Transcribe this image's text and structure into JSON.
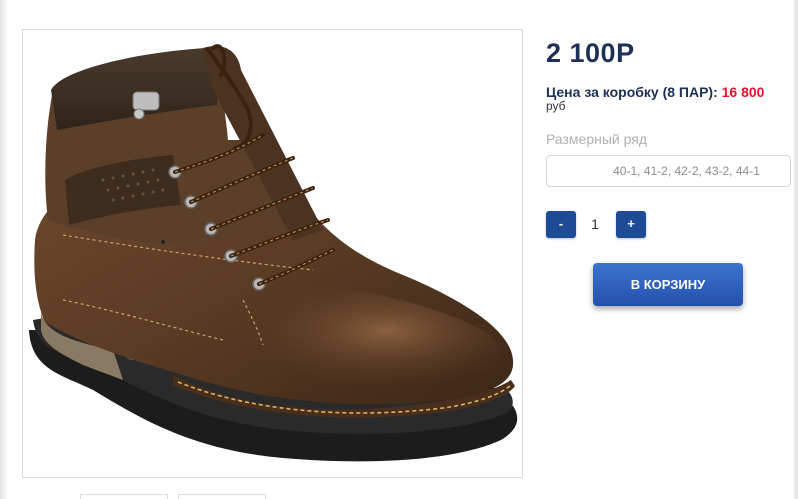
{
  "product": {
    "price": "2 100Р",
    "box_price_label": "Цена за коробку (8 ПАР):",
    "box_price_value": "16 800",
    "box_price_currency": "руб",
    "size_label": "Размерный ряд",
    "size_value": "40-1, 41-2, 42-2, 43-2, 44-1",
    "quantity": "1",
    "minus_label": "-",
    "plus_label": "+",
    "cart_button_label": "В КОРЗИНУ"
  },
  "image": {
    "subject": "brown-leather-lace-up-boot"
  },
  "colors": {
    "price_text": "#1f3057",
    "box_value_red": "#e3152c",
    "button_blue": "#1d4b95",
    "cart_button": "#2e5fbd"
  }
}
